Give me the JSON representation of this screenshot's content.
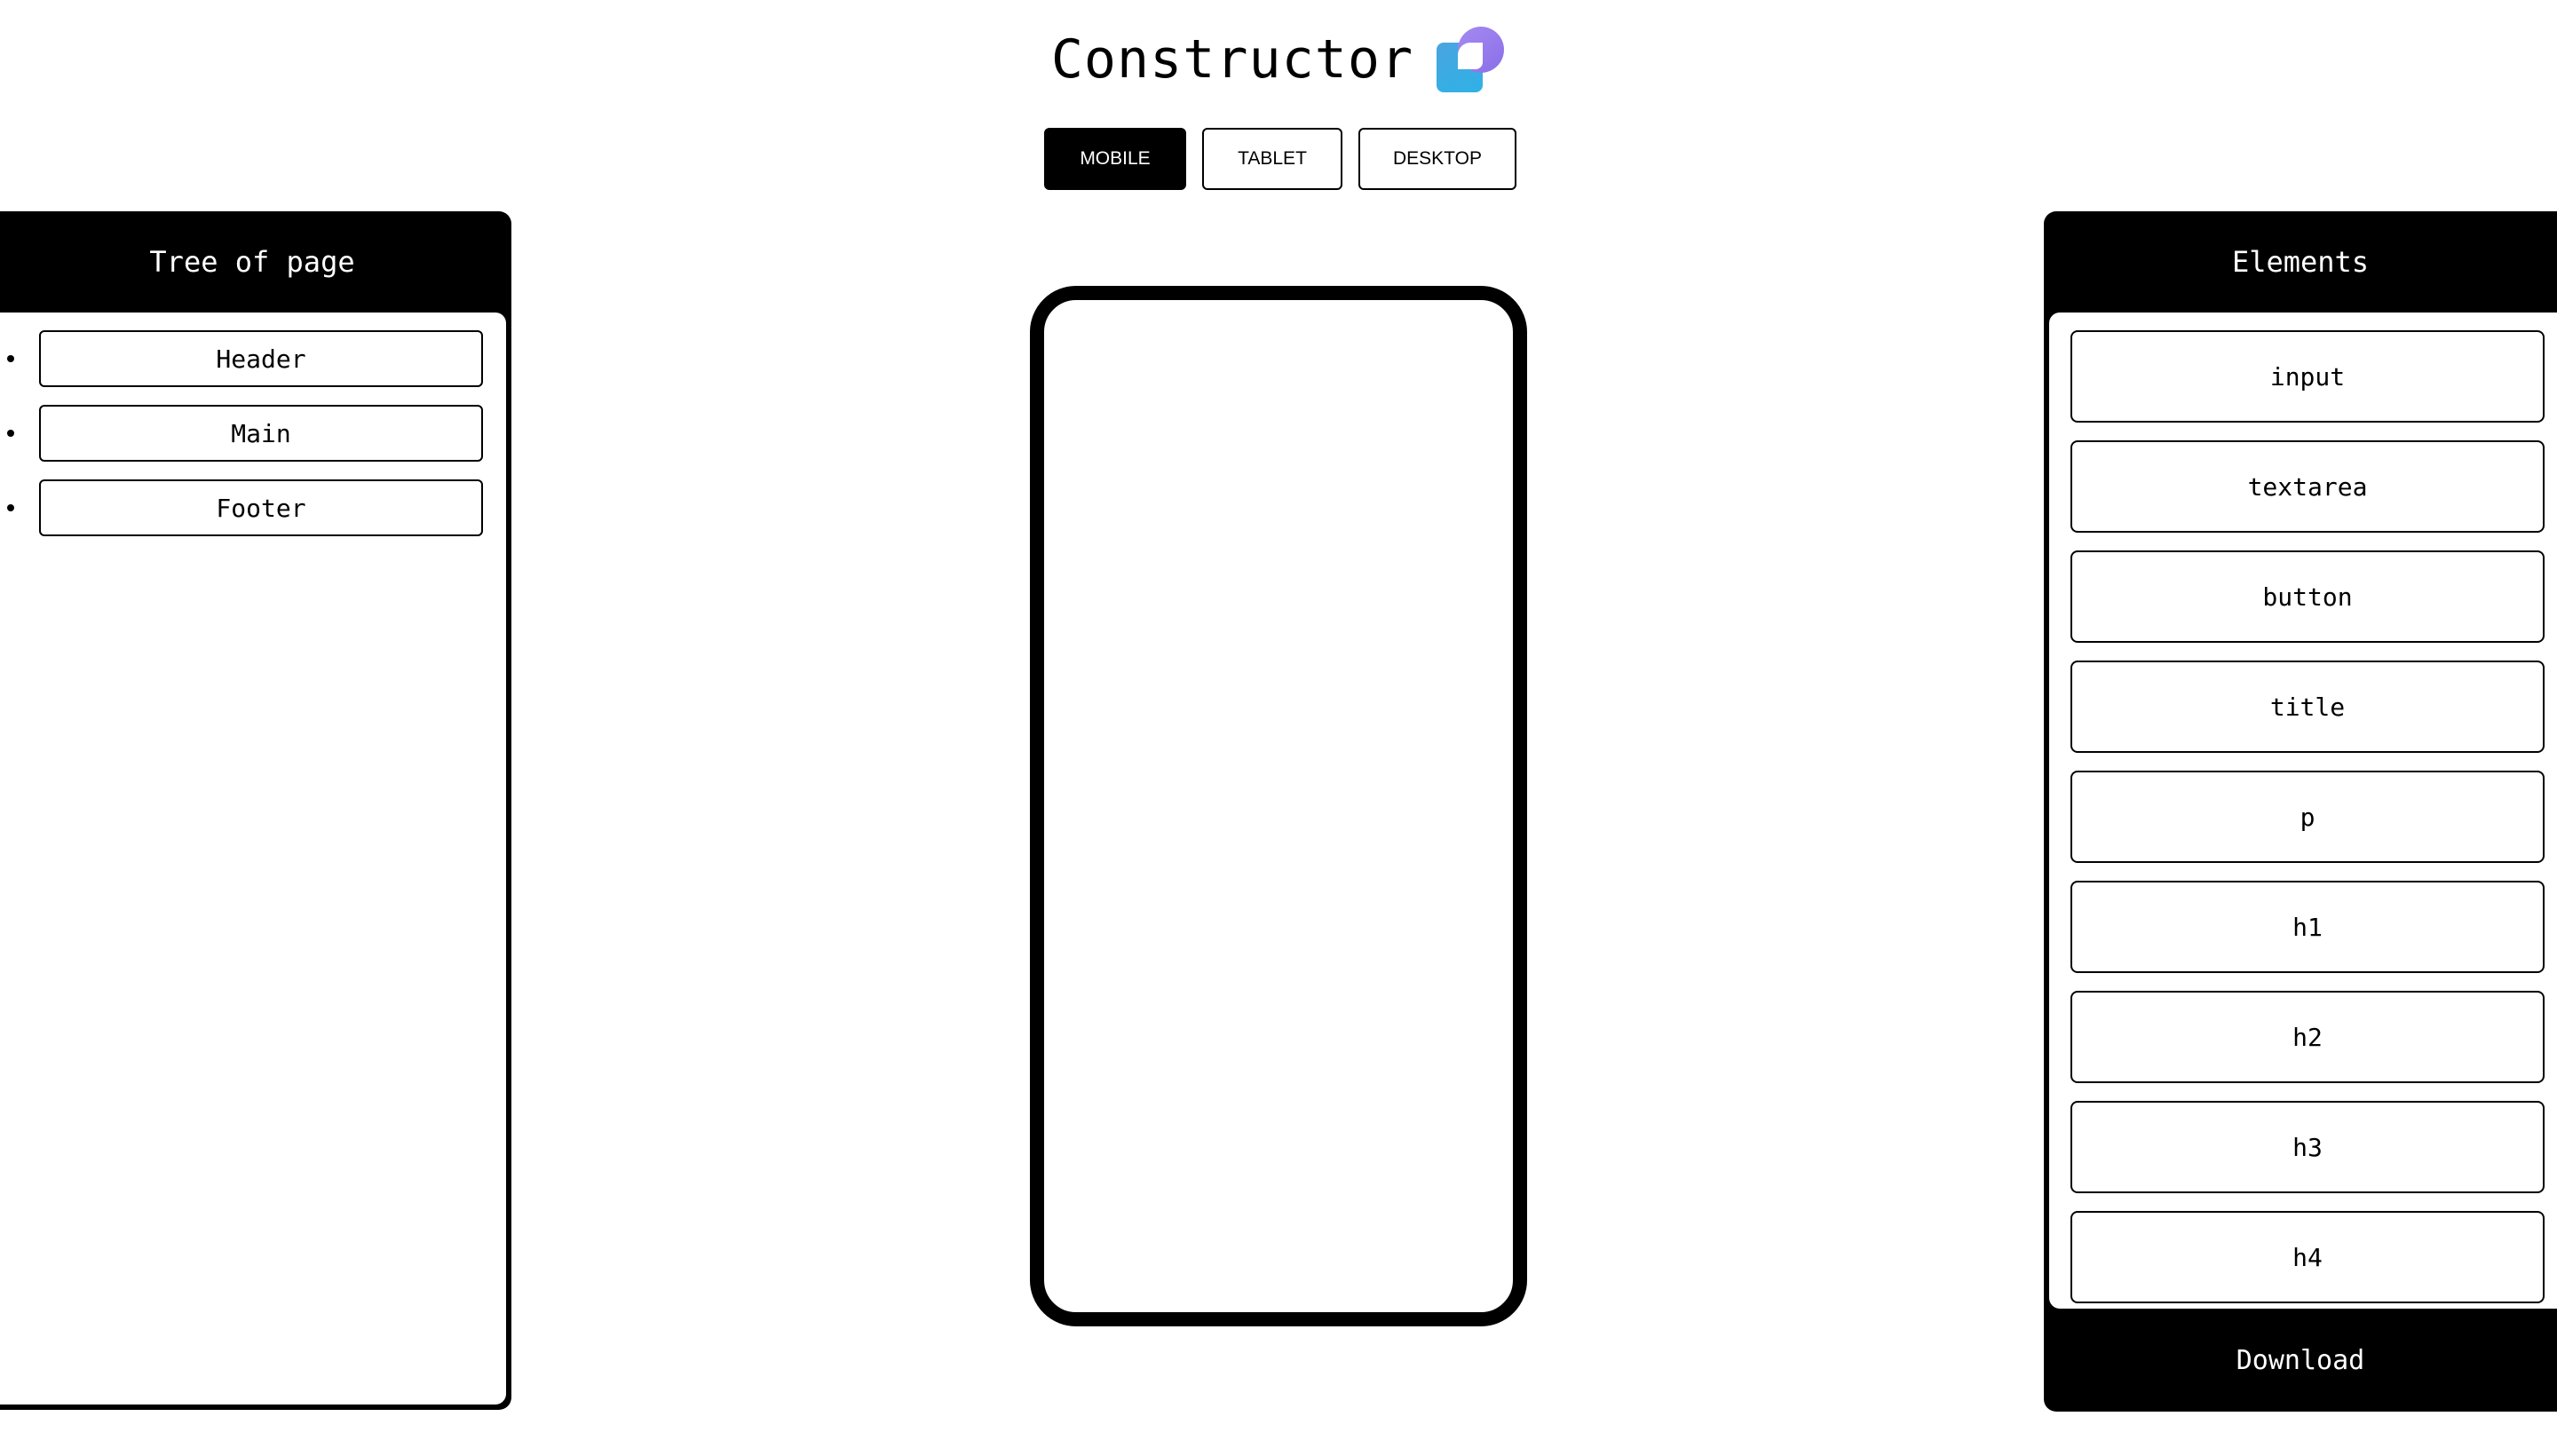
{
  "app": {
    "title": "Constructor",
    "logo_icon": "overlapping-square-circle-logo",
    "colors": {
      "logo_square": "#3aa8e4",
      "logo_circle": "#9b7ff0",
      "panel": "#000000"
    }
  },
  "device_tabs": [
    {
      "label": "MOBILE",
      "active": true
    },
    {
      "label": "TABLET",
      "active": false
    },
    {
      "label": "DESKTOP",
      "active": false
    }
  ],
  "tree": {
    "title": "Tree of page",
    "items": [
      "Header",
      "Main",
      "Footer"
    ]
  },
  "elements": {
    "title": "Elements",
    "items": [
      "input",
      "textarea",
      "button",
      "title",
      "p",
      "h1",
      "h2",
      "h3",
      "h4"
    ],
    "download_label": "Download"
  }
}
